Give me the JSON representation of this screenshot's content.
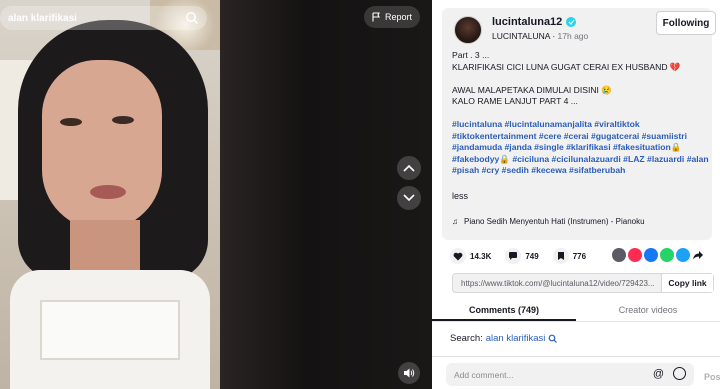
{
  "video": {
    "search_text": "alan klarifikasi",
    "report_label": "Report"
  },
  "author": {
    "username": "lucintaluna12",
    "display_name": "LUCINTALUNA",
    "time_ago": "17h ago",
    "follow_label": "Following"
  },
  "description": {
    "line1": "Part . 3 ...",
    "line2": "KLARIFIKASI CICI LUNA GUGAT CERAI EX HUSBAND 💔",
    "line3": "AWAL MALAPETAKA DIMULAI DISINI 😢",
    "line4": "KALO RAME LANJUT PART 4 ...",
    "hashtags": "#lucintaluna #lucintalunamanjalita #viraltiktok #tiktokentertainment #cere #cerai #gugatcerai #suamiistri #jandamuda #janda #single #klarifikasi #fakesituation🔒 #fakebodyy🔒 #ciciluna #cicilunalazuardi #LAZ #lazuardi #alan #pisah #cry #sedih #kecewa #sifatberubah",
    "less_label": "less"
  },
  "music": "Piano Sedih Menyentuh Hati (Instrumen) - Pianoku",
  "stats": {
    "likes": "14.3K",
    "comments": "749",
    "saves": "776"
  },
  "share": {
    "link": "https://www.tiktok.com/@lucintaluna12/video/729423...",
    "copy_label": "Copy link"
  },
  "tabs": {
    "comments": "Comments (749)",
    "creator_videos": "Creator videos"
  },
  "search_suggest": {
    "prefix": "Search:",
    "term": "alan klarifikasi"
  },
  "comment_bar": {
    "placeholder": "Add comment...",
    "post_label": "Post"
  },
  "colors": {
    "link_blue": "#2b5db9",
    "verified": "#20d5ec",
    "like_red": "#fe2c55"
  }
}
